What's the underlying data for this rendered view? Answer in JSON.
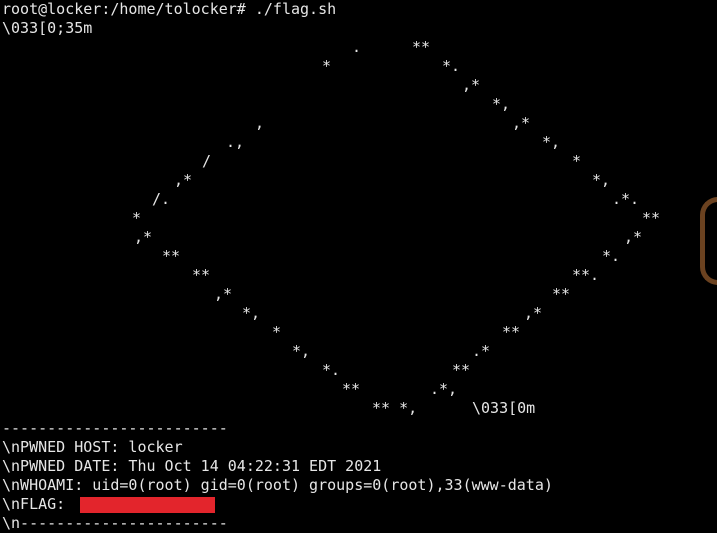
{
  "terminal": {
    "prompt_line": "root@locker:/home/tolocker# ./flag.sh",
    "escape_start": "\\033[0;35m",
    "escape_end": "\\033[0m",
    "divider_top": "-------------------------",
    "pwned_host": "\\nPWNED HOST: locker",
    "pwned_date": "\\nPWNED DATE: Thu Oct 14 04:22:31 EDT 2021",
    "whoami": "\\nWHOAMI: uid=0(root) gid=0(root) groups=0(root),33(www-data)",
    "flag_label": "\\nFLAG: ",
    "divider_bottom": "\\n-----------------------"
  },
  "ascii_art": [
    ".",
    "**",
    "*",
    "*.",
    ",*",
    "*,",
    ",",
    ",*",
    ".,",
    "*,",
    "*",
    "/",
    "*,",
    ",*",
    ".*.",
    "/.",
    "**",
    "*",
    ",*",
    ",*",
    "*.",
    "**",
    "**.",
    "**",
    "**",
    ",*",
    ",*",
    "*,",
    "**",
    "*",
    ".*",
    "*,",
    "**",
    "*.",
    ".*,",
    "**",
    "** *,"
  ],
  "colors": {
    "background": "#000000",
    "text": "#e6e6e6",
    "redaction": "#e3252c",
    "side_shape": "#6b4220"
  }
}
